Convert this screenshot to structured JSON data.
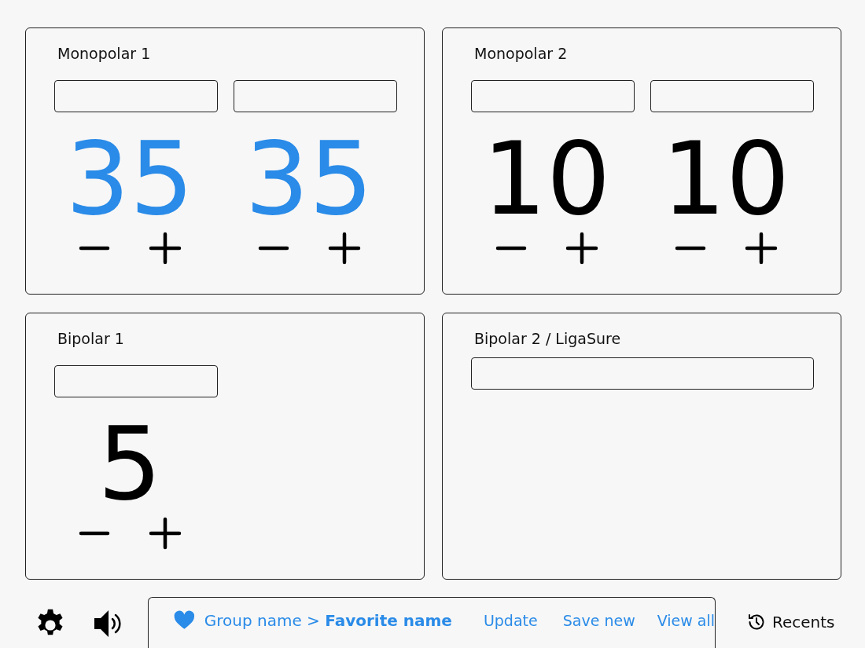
{
  "panels": [
    {
      "title": "Monopolar 1",
      "kind": "channels",
      "channels": [
        {
          "value": "35",
          "highlighted": true
        },
        {
          "value": "35",
          "highlighted": true
        }
      ]
    },
    {
      "title": "Monopolar 2",
      "kind": "channels",
      "channels": [
        {
          "value": "10",
          "highlighted": false
        },
        {
          "value": "10",
          "highlighted": false
        }
      ]
    },
    {
      "title": "Bipolar 1",
      "kind": "channels",
      "channels": [
        {
          "value": "5",
          "highlighted": false
        }
      ]
    },
    {
      "title": "Bipolar 2 / LigaSure",
      "kind": "wide"
    }
  ],
  "favorites": {
    "group": "Group name >",
    "favorite": "Favorite name",
    "actions": [
      "Update",
      "Save new",
      "View all"
    ]
  },
  "recents": {
    "label": "Recents"
  }
}
